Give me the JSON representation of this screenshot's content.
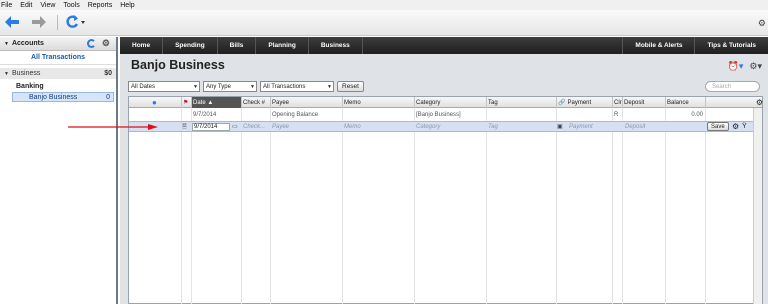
{
  "menu": [
    "File",
    "Edit",
    "View",
    "Tools",
    "Reports",
    "Help"
  ],
  "toolbar": {
    "back_icon": "back-arrow-icon",
    "forward_icon": "forward-arrow-icon",
    "refresh_icon": "refresh-icon",
    "gear_icon": "gear-icon",
    "accent": "#2a7be4"
  },
  "sidebar": {
    "title": "Accounts",
    "all_transactions": "All Transactions",
    "group_label": "Business",
    "group_amount": "$0",
    "category": "Banking",
    "account_name": "Banjo Business",
    "account_amount": "0"
  },
  "nav": {
    "left_tabs": [
      "Home",
      "Spending",
      "Bills",
      "Planning",
      "Business"
    ],
    "right_tabs": [
      "Mobile & Alerts",
      "Tips & Tutorials"
    ]
  },
  "main": {
    "title": "Banjo Business",
    "filters": {
      "dates": "All Dates",
      "type": "Any Type",
      "transactions": "All Transactions",
      "reset": "Reset",
      "search_placeholder": "Search"
    },
    "columns": {
      "date": "Date ▲",
      "check": "Check #",
      "payee": "Payee",
      "memo": "Memo",
      "category": "Category",
      "tag": "Tag",
      "payment": "Payment",
      "clr": "Clr",
      "deposit": "Deposit",
      "balance": "Balance"
    },
    "opening_row": {
      "date": "9/7/2014",
      "payee": "Opening Balance",
      "category": "[Banjo Business]",
      "clr": "R",
      "balance": "0.00"
    },
    "new_row": {
      "date": "9/7/2014",
      "check": "Check...",
      "payee": "Payee",
      "memo": "Memo",
      "category": "Category",
      "tag": "Tag",
      "payment": "Payment",
      "deposit": "Deposit",
      "save": "Save"
    }
  }
}
